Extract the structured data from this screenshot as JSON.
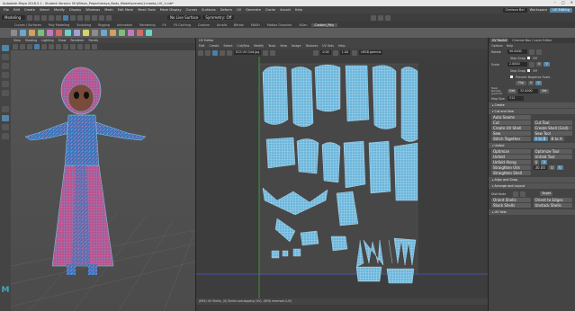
{
  "window_title": "Autodesk Maya 2018.5.1 - Student Version: M:\\Wilson_Project\\maya_Body_Model\\scenes\\1.meeta_UV_1.mb*",
  "menu": [
    "File",
    "Edit",
    "Create",
    "Select",
    "Modify",
    "Display",
    "Windows",
    "Mesh",
    "Edit Mesh",
    "Mesh Tools",
    "Mesh Display",
    "Curves",
    "Surfaces",
    "Deform",
    "UV",
    "Generate",
    "Cache",
    "Arnold",
    "Help"
  ],
  "menu_right": {
    "user": "Chelsea Bai",
    "workspace_label": "Workspace",
    "workspace": "UV Editing"
  },
  "status_line": {
    "mode": "Modeling",
    "live": "No Live Surface",
    "symmetry": "Symmetry: Off"
  },
  "shelf_tabs": [
    "Curves / Surfaces",
    "Poly Modeling",
    "Sculpting",
    "Rigging",
    "Animation",
    "Rendering",
    "FX",
    "FX Caching",
    "Custom",
    "Arnold",
    "Bifrost",
    "MASH",
    "Motion Graphics",
    "XGen",
    "Custom_Poly"
  ],
  "shelf_active": "Custom_Poly",
  "viewport": {
    "menu": [
      "View",
      "Shading",
      "Lighting",
      "Show",
      "Renderer",
      "Panels"
    ]
  },
  "uv_editor": {
    "title": "UV Editor",
    "menu": [
      "Edit",
      "Create",
      "Select",
      "Cut/Sew",
      "Modify",
      "Tools",
      "View",
      "Image",
      "Textures",
      "UV Sets",
      "Help"
    ],
    "texture": "ECS UV Grid.jpg",
    "exposure": "0.00",
    "gamma": "1.00",
    "colorspace": "sRGB gamma",
    "status": "(659) UV Shells, (0) Shells overlapping (UV), (659) reversed (UV)"
  },
  "toolkit": {
    "tabs": [
      "UV Toolkit",
      "Channel Box / Layer Editor"
    ],
    "menu": [
      "Options",
      "Help"
    ],
    "rotate_label": "Rotate",
    "rotate_value": "90.0000",
    "step_snap": "Step Snap",
    "off": "Off",
    "scale_label": "Scale",
    "scale_value": "2.0000",
    "u": "U",
    "v": "V",
    "preserve_neg": "Prevent Negative Scale",
    "flip": "Flip",
    "texel_label": "Texel Density (px/unit)",
    "get": "Get",
    "set": "Set",
    "texel_value": "32.0000",
    "map_size_label": "Map Size",
    "map_size": "512",
    "sections": {
      "create": "Create",
      "cut_sew": "Cut and Sew",
      "unfold": "Unfold",
      "align": "Align and Snap",
      "arrange": "Arrange and Layout",
      "uv_sets": "UV Sets"
    },
    "auto_seams": "Auto Seams",
    "cut": "Cut",
    "cut_tool": "Cut Tool",
    "create_uv_shell": "Create UV Shell",
    "create_shell_grid": "Create Shell (Grid)",
    "sew": "Sew",
    "sew_tool": "Sew Tool",
    "stitch_together": "Stitch Together",
    "a_to_b": "A to B",
    "b_to_a": "B to A",
    "optimize": "Optimize",
    "optimize_tool": "Optimize Tool",
    "unfold": "Unfold",
    "unfold_tool": "Unfold Tool",
    "unfold_along": "Unfold Along",
    "straighten_uvs": "Straighten UVs",
    "straighten_value": "30.00",
    "straighten_shell": "Straighten Shell",
    "distribute": "Distribute",
    "target": "Target",
    "orient_shells": "Orient Shells",
    "orient_to_edges": "Orient to Edges",
    "stack_shells": "Stack Shells",
    "unstack_shells": "Unstack Shells"
  }
}
